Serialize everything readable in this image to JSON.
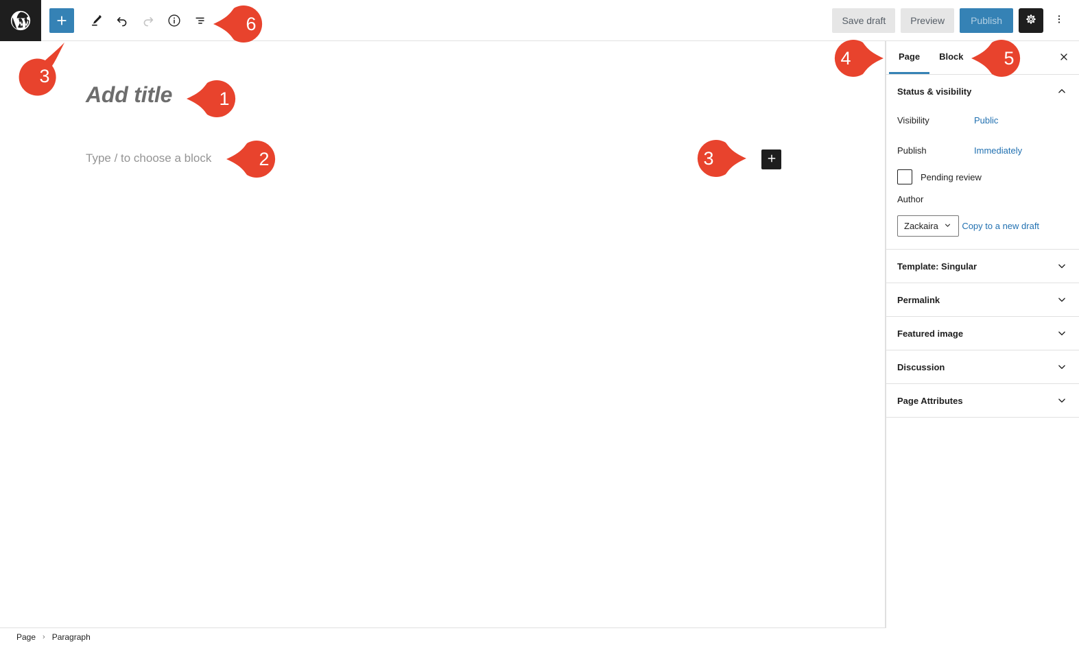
{
  "app": {
    "name": "WordPress Block Editor",
    "accent_blue": "#3582b5",
    "link_blue": "#2271b1",
    "callout_red": "#e8432d",
    "dark": "#1e1e1e"
  },
  "topbar": {
    "logo_icon": "wordpress-logo-icon",
    "tools": [
      {
        "name": "block-inserter-toggle",
        "icon": "plus-icon",
        "label": "Toggle block inserter",
        "state": "active"
      },
      {
        "name": "tool-edit-mode",
        "icon": "pencil-icon",
        "label": "Edit",
        "state": "enabled"
      },
      {
        "name": "tool-undo",
        "icon": "undo-arrow-icon",
        "label": "Undo",
        "state": "enabled"
      },
      {
        "name": "tool-redo",
        "icon": "redo-arrow-icon",
        "label": "Redo",
        "state": "disabled"
      },
      {
        "name": "tool-details",
        "icon": "info-circle-icon",
        "label": "Details",
        "state": "enabled"
      },
      {
        "name": "tool-list-view",
        "icon": "list-view-icon",
        "label": "List view",
        "state": "enabled"
      }
    ],
    "save_draft_label": "Save draft",
    "preview_label": "Preview",
    "publish_label": "Publish",
    "settings_icon": "gear-icon",
    "settings_label": "Settings",
    "options_icon": "kebab-menu-icon",
    "options_label": "Options"
  },
  "editor": {
    "title_placeholder": "Add title",
    "paragraph_placeholder": "Type / to choose a block",
    "inline_inserter_icon": "plus-icon",
    "inline_inserter_label": "Add block"
  },
  "sidebar": {
    "tabs": [
      {
        "label": "Page",
        "active": true
      },
      {
        "label": "Block",
        "active": false
      }
    ],
    "close_icon": "close-x-icon",
    "close_label": "Close settings",
    "panels": [
      {
        "title": "Status & visibility",
        "expanded": true,
        "chevron": "chevron-up-icon"
      },
      {
        "title": "Template: Singular",
        "expanded": false,
        "chevron": "chevron-down-icon"
      },
      {
        "title": "Permalink",
        "expanded": false,
        "chevron": "chevron-down-icon"
      },
      {
        "title": "Featured image",
        "expanded": false,
        "chevron": "chevron-down-icon"
      },
      {
        "title": "Discussion",
        "expanded": false,
        "chevron": "chevron-down-icon"
      },
      {
        "title": "Page Attributes",
        "expanded": false,
        "chevron": "chevron-down-icon"
      }
    ],
    "status": {
      "visibility_label": "Visibility",
      "visibility_value": "Public",
      "publish_label": "Publish",
      "publish_value": "Immediately",
      "pending_review_label": "Pending review",
      "pending_review_checked": false,
      "author_label": "Author",
      "author_value": "Zackaira",
      "author_chevron": "chevron-down-icon",
      "copy_draft_label": "Copy to a new draft"
    }
  },
  "breadcrumb": {
    "items": [
      "Page",
      "Paragraph"
    ],
    "separator": "›"
  },
  "callouts": [
    {
      "number": "1",
      "target": "post-title",
      "direction": "left"
    },
    {
      "number": "2",
      "target": "paragraph-placeholder",
      "direction": "left"
    },
    {
      "number": "3",
      "target": "block-inserter-toggle",
      "direction": "up-right"
    },
    {
      "number": "3",
      "target": "inline-block-inserter",
      "direction": "right"
    },
    {
      "number": "4",
      "target": "sidebar-tab-page",
      "direction": "right"
    },
    {
      "number": "5",
      "target": "sidebar-tab-block",
      "direction": "left"
    },
    {
      "number": "6",
      "target": "tool-list-view",
      "direction": "left"
    }
  ]
}
